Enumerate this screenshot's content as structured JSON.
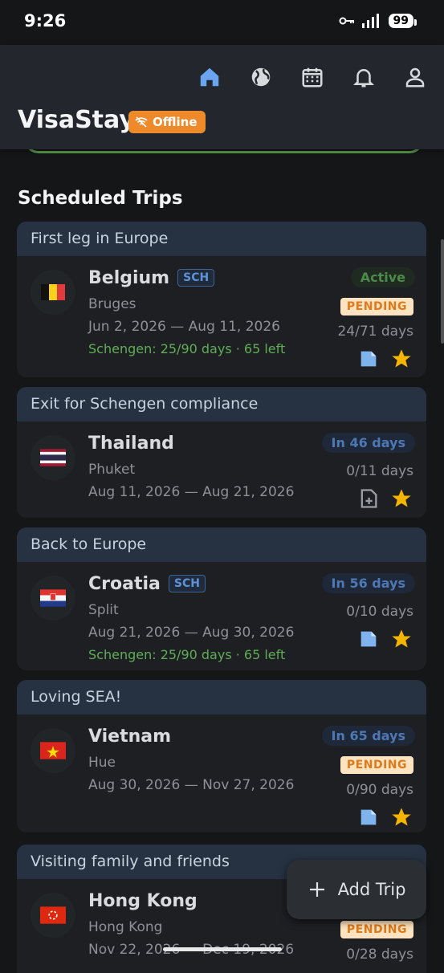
{
  "status_bar": {
    "time": "9:26",
    "battery": "99"
  },
  "app": {
    "title": "VisaStay",
    "offline_label": "Offline"
  },
  "nav": [
    "home-icon",
    "globe-icon",
    "calendar-icon",
    "bell-icon",
    "person-icon"
  ],
  "section_title": "Scheduled Trips",
  "colors": {
    "accent": "#ef8a2b",
    "schengen": "#5fae56",
    "pending_bg": "#fde3bf",
    "star": "#f4b400"
  },
  "trips": [
    {
      "group": "First leg in Europe",
      "country": "Belgium",
      "sch": "SCH",
      "city": "Bruges",
      "dates": "Jun 2, 2026 — Aug 11, 2026",
      "schengen": "Schengen: 25/90 days · 65 left",
      "status": "Active",
      "pending": "PENDING",
      "days": "24/71 days",
      "doc": "document-icon",
      "favorite": "star-icon"
    },
    {
      "group": "Exit for Schengen compliance",
      "country": "Thailand",
      "city": "Phuket",
      "dates": "Aug 11, 2026 — Aug 21, 2026",
      "status": "In 46 days",
      "days": "0/11 days",
      "doc": "add-document-icon",
      "favorite": "star-icon"
    },
    {
      "group": "Back to Europe",
      "country": "Croatia",
      "sch": "SCH",
      "city": "Split",
      "dates": "Aug 21, 2026 — Aug 30, 2026",
      "schengen": "Schengen: 25/90 days · 65 left",
      "status": "In 56 days",
      "days": "0/10 days",
      "doc": "document-icon",
      "favorite": "star-icon"
    },
    {
      "group": "Loving SEA!",
      "country": "Vietnam",
      "city": "Hue",
      "dates": "Aug 30, 2026 — Nov 27, 2026",
      "status": "In 65 days",
      "pending": "PENDING",
      "days": "0/90 days",
      "doc": "document-icon",
      "favorite": "star-icon"
    },
    {
      "group": "Visiting family and friends",
      "country": "Hong Kong",
      "city": "Hong Kong",
      "dates": "Nov 22, 2026 — Dec 19, 2026",
      "pending": "PENDING",
      "days": "0/28 days"
    }
  ],
  "fab": {
    "label": "Add Trip"
  }
}
